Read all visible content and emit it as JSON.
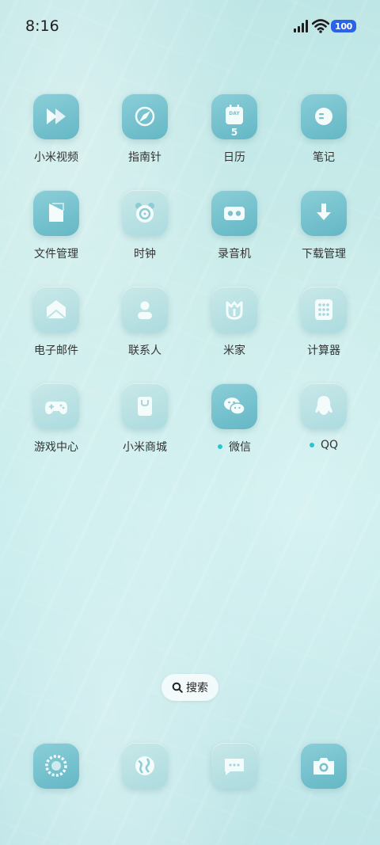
{
  "status_bar": {
    "time": "8:16",
    "battery": "100",
    "battery_color": "#2b63e8",
    "icons": [
      "signal-icon",
      "wifi-icon"
    ]
  },
  "apps": [
    {
      "label": "小米视频",
      "icon": "play-icon",
      "dot": false
    },
    {
      "label": "指南针",
      "icon": "compass-icon",
      "dot": false
    },
    {
      "label": "日历",
      "icon": "calendar-icon",
      "calendar_day": "5",
      "calendar_text": "DAY",
      "dot": false
    },
    {
      "label": "笔记",
      "icon": "notes-icon",
      "dot": false
    },
    {
      "label": "文件管理",
      "icon": "folder-icon",
      "dot": false
    },
    {
      "label": "时钟",
      "icon": "alarm-clock-icon",
      "dot": false
    },
    {
      "label": "录音机",
      "icon": "recorder-icon",
      "dot": false
    },
    {
      "label": "下载管理",
      "icon": "download-icon",
      "dot": false
    },
    {
      "label": "电子邮件",
      "icon": "mail-icon",
      "dot": false
    },
    {
      "label": "联系人",
      "icon": "contact-icon",
      "dot": false
    },
    {
      "label": "米家",
      "icon": "mijia-icon",
      "dot": false
    },
    {
      "label": "计算器",
      "icon": "calculator-icon",
      "dot": false
    },
    {
      "label": "游戏中心",
      "icon": "gamepad-icon",
      "dot": false
    },
    {
      "label": "小米商城",
      "icon": "shopping-bag-icon",
      "dot": false
    },
    {
      "label": "微信",
      "icon": "wechat-icon",
      "dot": true
    },
    {
      "label": "QQ",
      "icon": "qq-penguin-icon",
      "dot": true
    }
  ],
  "search": {
    "label": "搜索",
    "icon": "search-icon"
  },
  "dock": [
    {
      "icon": "phone-dial-icon"
    },
    {
      "icon": "browser-globe-icon"
    },
    {
      "icon": "message-icon"
    },
    {
      "icon": "camera-icon"
    }
  ],
  "colors": {
    "icon_tint": "#6cbcc9",
    "notification_dot": "#2cc4d0"
  }
}
